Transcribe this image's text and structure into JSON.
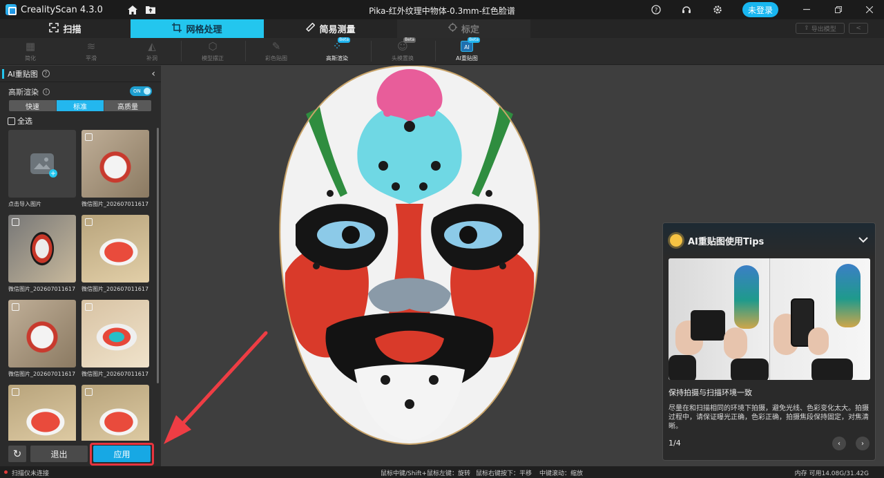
{
  "app": {
    "name": "CrealityScan 4.3.0",
    "window_title": "Pika-红外纹理中物体-0.3mm-红色脸谱",
    "login_label": "未登录"
  },
  "tabs": [
    {
      "label": "扫描",
      "icon": "scan-frame-icon"
    },
    {
      "label": "网格处理",
      "icon": "mesh-crop-icon"
    },
    {
      "label": "简易测量",
      "icon": "ruler-icon"
    },
    {
      "label": "标定",
      "icon": "calibrate-icon"
    }
  ],
  "right_buttons": {
    "export": "导出模型",
    "share": ""
  },
  "tools": [
    {
      "label": "简化",
      "beta": false
    },
    {
      "label": "平滑",
      "beta": false
    },
    {
      "label": "补洞",
      "beta": false
    },
    {
      "label": "模型摆正",
      "beta": false
    },
    {
      "label": "彩色贴图",
      "beta": false
    },
    {
      "label": "高斯渲染",
      "beta": true,
      "beta_label": "Beta"
    },
    {
      "label": "头模置换",
      "beta": true,
      "beta_label": "Beta"
    },
    {
      "label": "AI重贴图",
      "beta": true,
      "beta_label": "Beta"
    }
  ],
  "panel": {
    "title": "AI重贴图",
    "gaussian_label": "高斯渲染",
    "toggle_label": "ON",
    "quality": [
      "快速",
      "标准",
      "高质量"
    ],
    "select_all": "全选",
    "items": [
      {
        "caption": "点击导入图片"
      },
      {
        "caption": "微信图片_2026070116171..."
      },
      {
        "caption": "微信图片_2026070116171..."
      },
      {
        "caption": "微信图片_2026070116171..."
      },
      {
        "caption": "微信图片_2026070116171..."
      },
      {
        "caption": "微信图片_2026070116171..."
      },
      {
        "caption": ""
      },
      {
        "caption": ""
      }
    ],
    "exit_label": "退出",
    "apply_label": "应用"
  },
  "tips": {
    "title": "AI重贴图使用Tips",
    "subtitle": "保持拍摄与扫描环境一致",
    "body": "尽量在和扫描相同的环境下拍摄，避免光线、色彩变化太大。拍摄过程中，请保证曝光正确，色彩正确，拍摄焦段保持固定，对焦清晰。",
    "page": "1/4"
  },
  "status": {
    "connection": "扫描仪未连接",
    "hint1": "鼠标中键/Shift+鼠标左键：旋转",
    "hint2": "鼠标右键按下：平移",
    "hint3": "中键滚动：缩放",
    "memory": "内存  可用14.08G/31.42G"
  },
  "colors": {
    "accent": "#23c6ee",
    "apply": "#17a8e4",
    "highlight": "#e8343f"
  }
}
